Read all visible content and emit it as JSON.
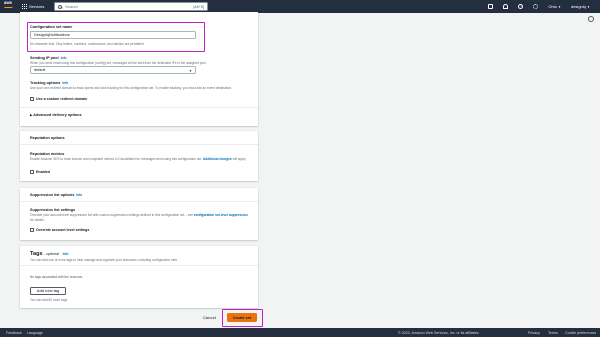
{
  "topnav": {
    "logo_text": "aws",
    "services_label": "Services",
    "search_placeholder": "Search",
    "search_shortcut": "[Alt+S]",
    "region": "Ohio",
    "account": "designiq"
  },
  "config_set": {
    "label": "Configuration set name",
    "value": "DesignIqNotifications",
    "hint": "64 character limit. Only letters, numbers, underscores, and dashes are permitted."
  },
  "sending_ip": {
    "label": "Sending IP pool",
    "info": "Info",
    "desc": "When you send email using this configuration (config) set, messages will be sent from the dedicated IPs in the assigned pool.",
    "value": "default"
  },
  "tracking": {
    "label": "Tracking options",
    "info": "Info",
    "desc": "Use your own redirect domain to track opens and click tracking for this configuration set. To enable tracking, you must add an event destination.",
    "checkbox_label": "Use a custom redirect domain"
  },
  "advanced": {
    "label": "Advanced delivery options"
  },
  "reputation": {
    "header": "Reputation options",
    "metrics_label": "Reputation metrics",
    "desc_prefix": "Enable Amazon SES to track bounce and complaint metrics in CloudWatch for messages sent using this configuration set.",
    "link": "Additional charges",
    "desc_suffix": "will apply.",
    "checkbox_label": "Enabled"
  },
  "suppression": {
    "header": "Suppression list options",
    "info": "Info",
    "settings_label": "Suppression list settings",
    "desc_prefix": "Override your account-level suppression list with custom suppression settings defined in this configuration set – see",
    "link": "configuration set-level suppression",
    "desc_suffix": "for details.",
    "checkbox_label": "Override account level settings"
  },
  "tags": {
    "title": "Tags",
    "optional": "- optional",
    "info": "Info",
    "desc": "You can add one or more tags to help manage and organize your resources, including configuration sets.",
    "empty": "No tags associated with the resource.",
    "add_button": "Add new tag",
    "limit": "You can add 50 more tags."
  },
  "actions": {
    "cancel": "Cancel",
    "create": "Create set"
  },
  "footer": {
    "feedback": "Feedback",
    "language": "Language",
    "copyright": "© 2023, Amazon Web Services, Inc. or its affiliates.",
    "privacy": "Privacy",
    "terms": "Terms",
    "cookies": "Cookie preferences"
  },
  "colors": {
    "nav_bg": "#232f3e",
    "primary": "#ec7211",
    "link": "#0073bb",
    "highlight": "#c21fc7"
  }
}
